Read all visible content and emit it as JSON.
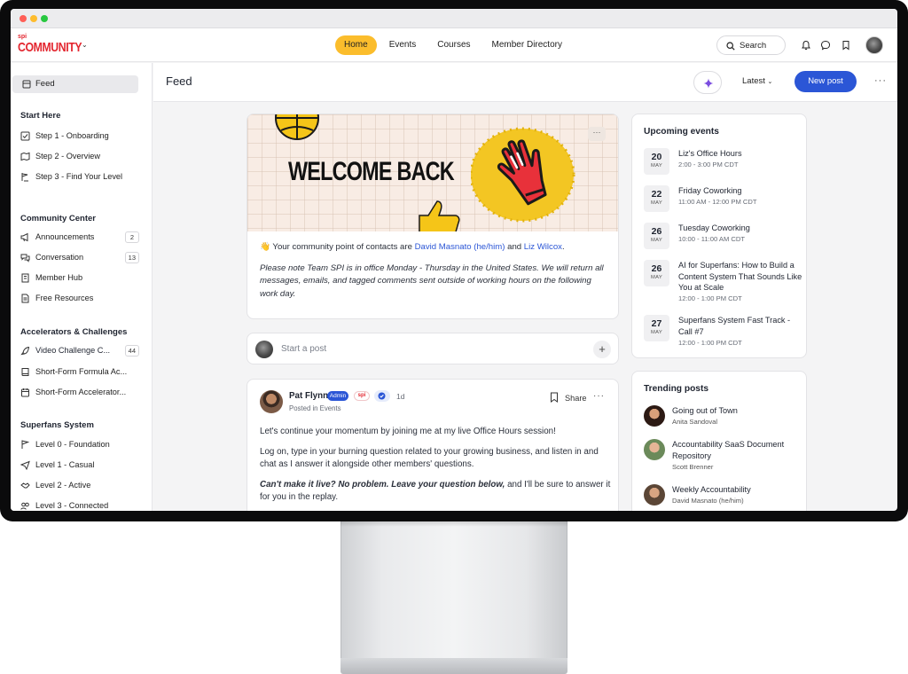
{
  "nav": {
    "logo_small": "spi",
    "logo_word": "COMMUNITY",
    "tabs": [
      "Home",
      "Events",
      "Courses",
      "Member Directory"
    ],
    "search_label": "Search"
  },
  "sidebar": {
    "feed_label": "Feed",
    "sections": [
      {
        "title": "Start Here",
        "items": [
          {
            "label": "Step 1 - Onboarding"
          },
          {
            "label": "Step 2 - Overview"
          },
          {
            "label": "Step 3 - Find Your Level"
          }
        ]
      },
      {
        "title": "Community Center",
        "items": [
          {
            "label": "Announcements",
            "count": "2"
          },
          {
            "label": "Conversation",
            "count": "13"
          },
          {
            "label": "Member Hub"
          },
          {
            "label": "Free Resources"
          }
        ]
      },
      {
        "title": "Accelerators & Challenges",
        "items": [
          {
            "label": "Video Challenge C...",
            "count": "44"
          },
          {
            "label": "Short-Form Formula Ac..."
          },
          {
            "label": "Short-Form Accelerator..."
          }
        ]
      },
      {
        "title": "Superfans System",
        "items": [
          {
            "label": "Level 0 - Foundation"
          },
          {
            "label": "Level 1 - Casual"
          },
          {
            "label": "Level 2 - Active"
          },
          {
            "label": "Level 3 - Connected"
          }
        ]
      }
    ]
  },
  "header": {
    "title": "Feed",
    "sort_label": "Latest",
    "new_post_label": "New post"
  },
  "welcome": {
    "banner_text": "WELCOME BACK",
    "intro_prefix": "👋 Your community point of contacts are ",
    "contact_1": "David Masnato (he/him)",
    "and": " and ",
    "contact_2": "Liz Wilcox",
    "period": ".",
    "note": "Please note Team SPI is in office Monday - Thursday in the United States. We will return all messages, emails, and tagged comments sent outside of working hours on the following work day."
  },
  "composer": {
    "placeholder": "Start a post"
  },
  "post": {
    "author": "Pat Flynn",
    "admin_badge": "Admin",
    "spi_badge": "spi",
    "time": "1d",
    "posted_in": "Posted in Events",
    "share_label": "Share",
    "p1": "Let's continue your momentum by joining me at my live Office Hours session!",
    "p2": "Log on, type in your burning question related to your growing business, and listen in and chat as I answer it alongside other members' questions.",
    "p3_em": "Can't make it live? No problem. Leave your question below,",
    "p3_rest": " and I'll be sure to answer it for you in the replay."
  },
  "events": {
    "title": "Upcoming events",
    "items": [
      {
        "day": "20",
        "month": "MAY",
        "title": "Liz's Office Hours",
        "time": "2:00 - 3:00 PM CDT"
      },
      {
        "day": "22",
        "month": "MAY",
        "title": "Friday Coworking",
        "time": "11:00 AM - 12:00 PM CDT"
      },
      {
        "day": "26",
        "month": "MAY",
        "title": "Tuesday Coworking",
        "time": "10:00 - 11:00 AM CDT"
      },
      {
        "day": "26",
        "month": "MAY",
        "title": "AI for Superfans: How to Build a Content System That Sounds Like You at Scale",
        "time": "12:00 - 1:00 PM CDT"
      },
      {
        "day": "27",
        "month": "MAY",
        "title": "Superfans System Fast Track - Call #7",
        "time": "12:00 - 1:00 PM CDT"
      }
    ]
  },
  "trending": {
    "title": "Trending posts",
    "items": [
      {
        "title": "Going out of Town",
        "author": "Anita Sandoval"
      },
      {
        "title": "Accountability SaaS Document Repository",
        "author": "Scott Brenner"
      },
      {
        "title": "Weekly Accountability",
        "author": "David Masnato (he/him)"
      }
    ]
  },
  "colors": {
    "accent_yellow": "#fbbd2c",
    "primary_blue": "#2b56d6",
    "brand_red": "#e3262f"
  }
}
